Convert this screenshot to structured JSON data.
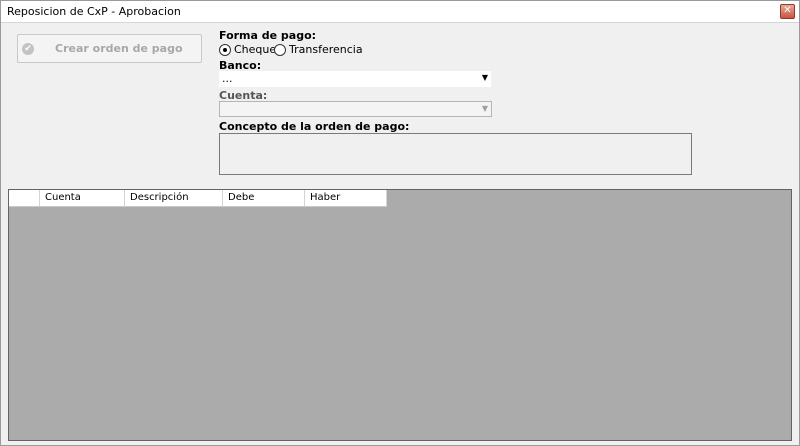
{
  "window": {
    "title": "Reposicion de CxP - Aprobacion",
    "close_glyph": "✕"
  },
  "crear_button": {
    "label": "Crear orden de pago",
    "icon": "check-circle-icon",
    "enabled": false
  },
  "forma_pago": {
    "label": "Forma de pago:",
    "options": [
      {
        "label": "Cheque",
        "selected": true
      },
      {
        "label": "Transferencia",
        "selected": false
      }
    ]
  },
  "banco": {
    "label": "Banco:",
    "value": "..."
  },
  "cuenta": {
    "label": "Cuenta:",
    "value": "",
    "enabled": false
  },
  "concepto": {
    "label": "Concepto de la orden de pago:",
    "value": ""
  },
  "grid": {
    "columns": [
      "Cuenta",
      "Descripción",
      "Debe",
      "Haber"
    ],
    "rows": []
  },
  "colors": {
    "grid_background": "#ababab",
    "window_background": "#f0f0f0"
  }
}
